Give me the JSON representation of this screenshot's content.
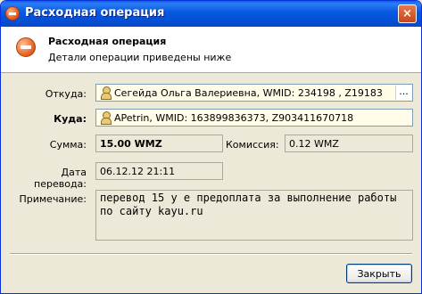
{
  "window": {
    "title": "Расходная операция",
    "close_glyph": "×"
  },
  "header": {
    "title": "Расходная операция",
    "subtitle": "Детали операции приведены ниже",
    "icon": "minus-circle-icon"
  },
  "form": {
    "from_label": "Откуда:",
    "from_value": "Сегейда Ольга Валериевна, WMID: 234198        , Z19183",
    "from_more": "...",
    "to_label": "Куда:",
    "to_value": "APetrin, WMID: 163899836373, Z903411670718",
    "amount_label": "Сумма:",
    "amount_value": "15.00 WMZ",
    "fee_label": "Комиссия:",
    "fee_value": "0.12 WMZ",
    "date_label": "Дата перевода:",
    "date_value": "06.12.12 21:11",
    "note_label": "Примечание:",
    "note_value": "перевод 15 у е предоплата за выполнение работы\nпо сайту kayu.ru"
  },
  "buttons": {
    "close_label": "Закрыть"
  }
}
